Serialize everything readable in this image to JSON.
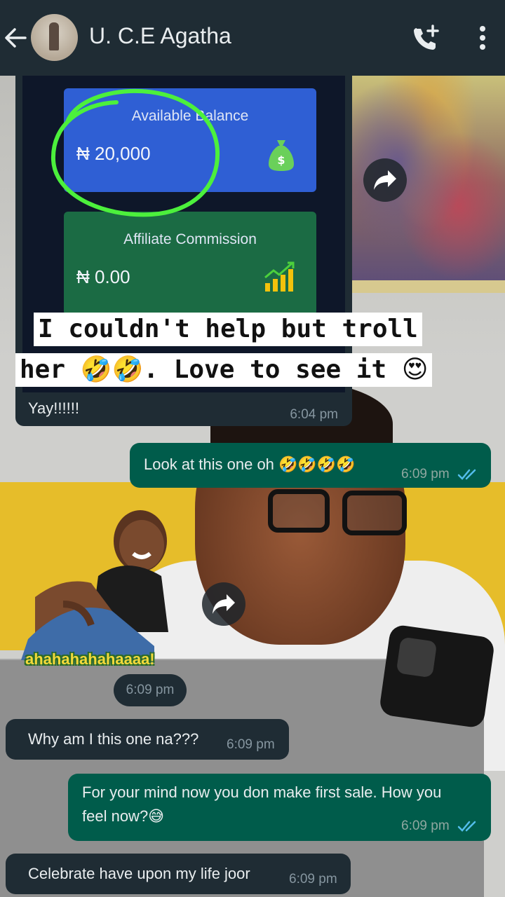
{
  "header": {
    "contact_name": "U. C.E Agatha",
    "back_icon": "arrow-left-icon",
    "call_icon": "phone-add-icon",
    "menu_icon": "more-vertical-icon"
  },
  "forwarded_image": {
    "balance_card": {
      "title": "Available Balance",
      "amount": "₦ 20,000",
      "icon": "money-bag-icon"
    },
    "commission_card": {
      "title": "Affiliate Commission",
      "amount": "₦ 0.00",
      "icon": "bar-chart-icon"
    },
    "caption_line1": "I couldn't help but troll",
    "caption_line2_text": "her",
    "caption_line2_emoji": "🤣🤣",
    "caption_line2_rest": ". Love to see it",
    "caption_line2_end_emoji": "😍",
    "reply_text": "Yay!!!!!!",
    "reply_time": "6:04 pm"
  },
  "messages": [
    {
      "id": "m1",
      "direction": "out",
      "text": "Look at this one oh 🤣🤣🤣🤣",
      "time": "6:09 pm",
      "ticks": "read"
    },
    {
      "id": "m2",
      "direction": "in",
      "type": "sticker",
      "sticker_text": "ahahahahahaaaa!",
      "time": "6:09 pm"
    },
    {
      "id": "m3",
      "direction": "in",
      "text": "Why am I this one na???",
      "time": "6:09 pm"
    },
    {
      "id": "m4",
      "direction": "out",
      "text_line1": "For your mind now you don make first sale. How you",
      "text_line2": "feel now?😅",
      "time": "6:09 pm",
      "ticks": "read"
    },
    {
      "id": "m5",
      "direction": "in",
      "text": "Celebrate have upon my life joor",
      "time": "6:09 pm"
    }
  ],
  "colors": {
    "header_bg": "#1f2c34",
    "incoming_bubble": "#1f2c34",
    "outgoing_bubble": "#005c4b",
    "read_ticks": "#53bdeb",
    "balance_card": "#2f5fd4",
    "commission_card": "#1b6b44",
    "highlight_circle": "#4cf03c"
  }
}
